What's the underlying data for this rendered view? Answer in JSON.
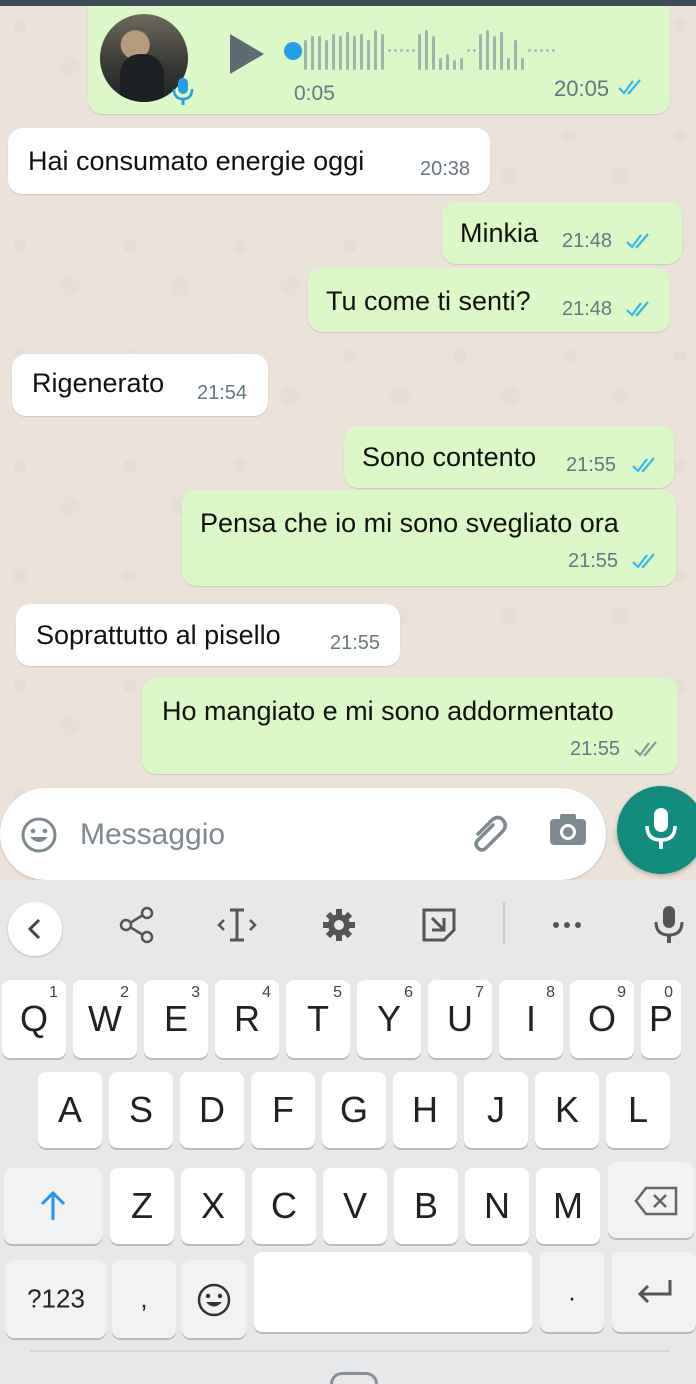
{
  "colors": {
    "chat_bg": "#ebe3da",
    "incoming_bubble": "#ffffff",
    "outgoing_bubble": "#dcf8c6",
    "read_ticks": "#34b7f1",
    "fab_green": "#128c7e"
  },
  "voice_message": {
    "duration": "0:05",
    "time": "20:05",
    "status": "read"
  },
  "messages": [
    {
      "direction": "in",
      "text": "Hai consumato energie oggi",
      "time": "20:38"
    },
    {
      "direction": "out",
      "text": "Minkia",
      "time": "21:48",
      "status": "read"
    },
    {
      "direction": "out",
      "text": "Tu come ti senti?",
      "time": "21:48",
      "status": "read"
    },
    {
      "direction": "in",
      "text": "Rigenerato",
      "time": "21:54"
    },
    {
      "direction": "out",
      "text": "Sono contento",
      "time": "21:55",
      "status": "read"
    },
    {
      "direction": "out",
      "text": "Pensa che io mi sono svegliato ora",
      "time": "21:55",
      "status": "read"
    },
    {
      "direction": "in",
      "text": "Soprattutto al pisello",
      "time": "21:55"
    },
    {
      "direction": "out",
      "text": "Ho mangiato e mi sono addormentato",
      "time": "21:55",
      "status": "delivered"
    }
  ],
  "composer": {
    "placeholder": "Messaggio"
  },
  "keyboard": {
    "row1": [
      {
        "label": "Q",
        "hint": "1"
      },
      {
        "label": "W",
        "hint": "2"
      },
      {
        "label": "E",
        "hint": "3"
      },
      {
        "label": "R",
        "hint": "4"
      },
      {
        "label": "T",
        "hint": "5"
      },
      {
        "label": "Y",
        "hint": "6"
      },
      {
        "label": "U",
        "hint": "7"
      },
      {
        "label": "I",
        "hint": "8"
      },
      {
        "label": "O",
        "hint": "9"
      },
      {
        "label": "P",
        "hint": "0"
      }
    ],
    "row2": [
      "A",
      "S",
      "D",
      "F",
      "G",
      "H",
      "J",
      "K",
      "L"
    ],
    "row3": [
      "Z",
      "X",
      "C",
      "V",
      "B",
      "N",
      "M"
    ],
    "symbols_label": "?123",
    "comma_label": ",",
    "period_label": "."
  }
}
